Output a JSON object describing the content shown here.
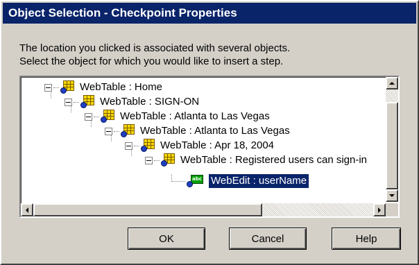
{
  "dialog": {
    "title": "Object Selection - Checkpoint Properties",
    "description_line1": "The location you clicked is associated with several objects.",
    "description_line2": "Select the object for which you would like to insert a step."
  },
  "tree": {
    "nodes": [
      {
        "label": "WebTable : Home",
        "icon": "webtable-icon",
        "expanded": true
      },
      {
        "label": "WebTable : SIGN-ON",
        "icon": "webtable-icon",
        "expanded": true
      },
      {
        "label": "WebTable : Atlanta to Las Vegas",
        "icon": "webtable-icon",
        "expanded": true
      },
      {
        "label": "WebTable : Atlanta to Las Vegas",
        "icon": "webtable-icon",
        "expanded": true
      },
      {
        "label": "WebTable : Apr 18, 2004",
        "icon": "webtable-icon",
        "expanded": true
      },
      {
        "label": "WebTable : Registered users can sign-in",
        "icon": "webtable-icon",
        "expanded": true
      },
      {
        "label": "WebEdit : userName",
        "icon": "webedit-icon",
        "selected": true
      }
    ]
  },
  "buttons": {
    "ok": "OK",
    "cancel": "Cancel",
    "help": "Help"
  },
  "colors": {
    "titlebar": "#0a246a",
    "face": "#d4d0c8",
    "selection": "#0a246a"
  }
}
